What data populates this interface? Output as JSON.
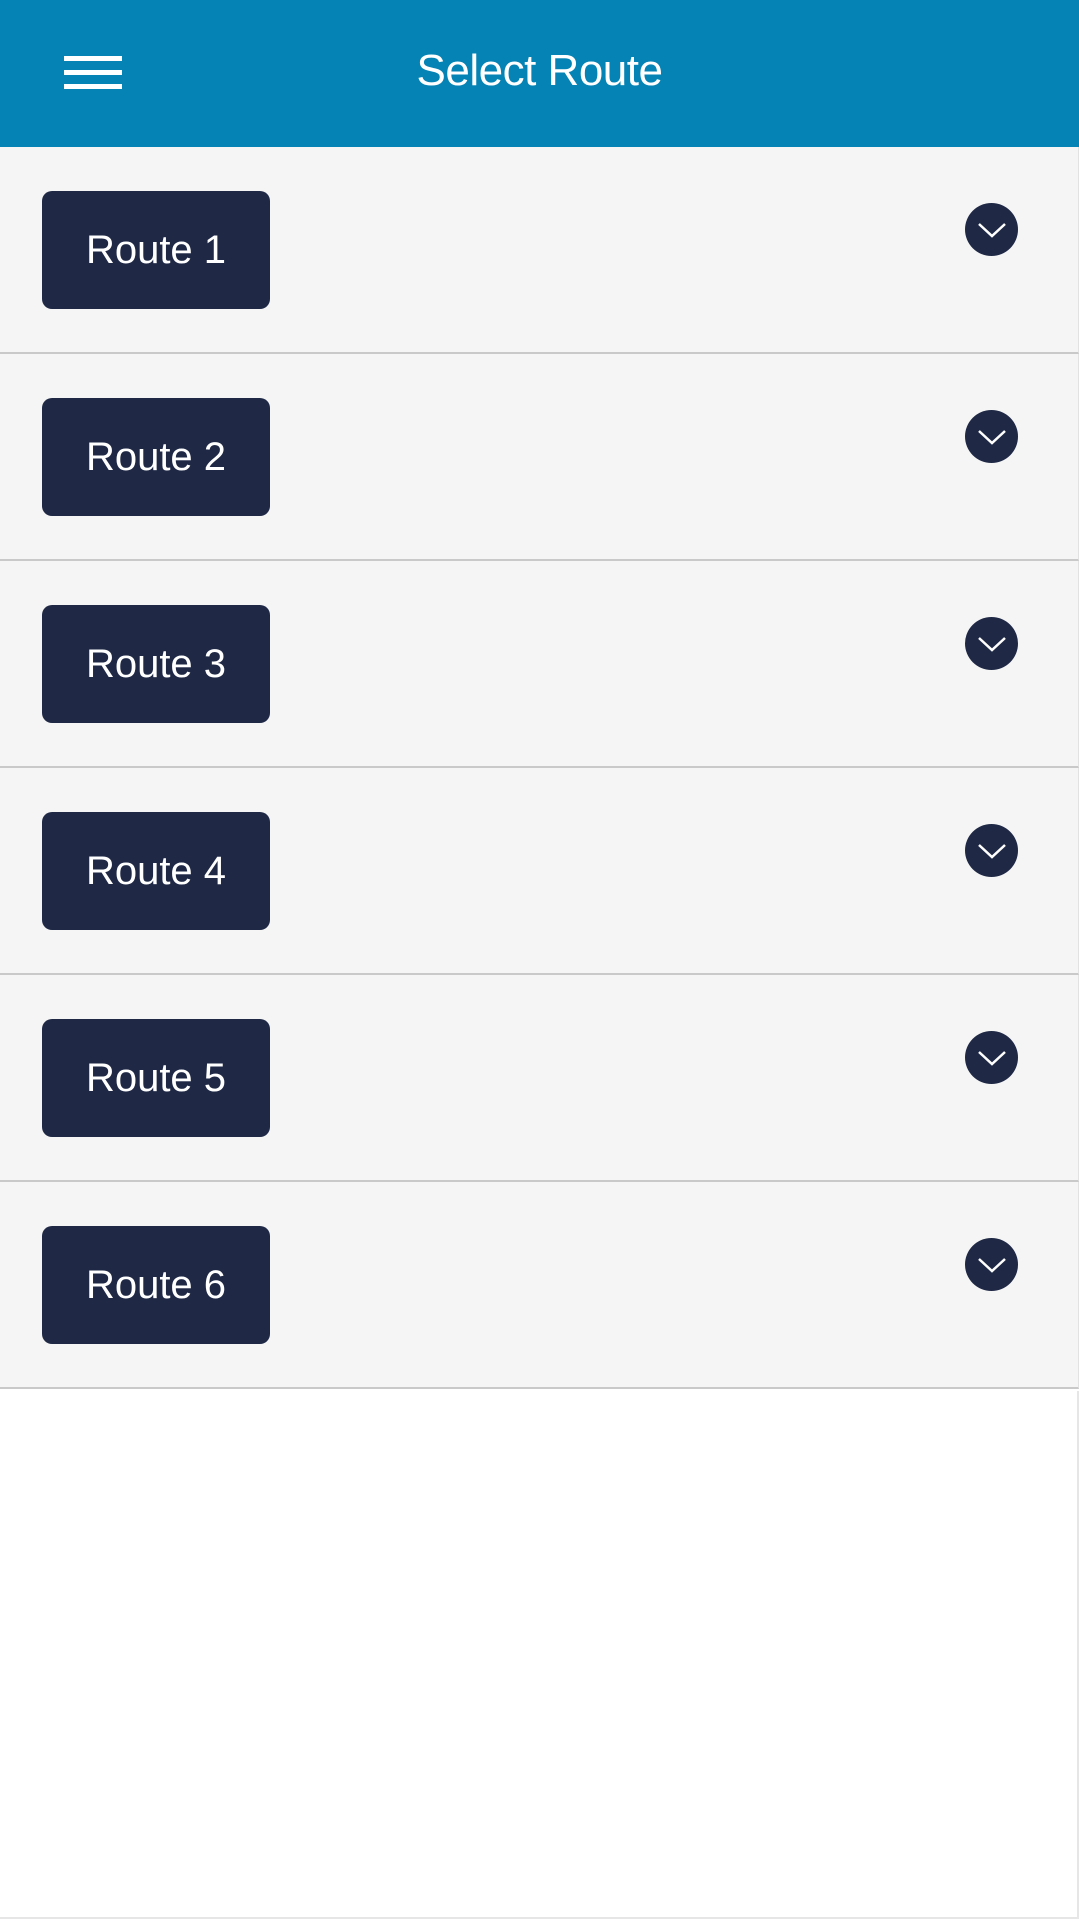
{
  "app_bar": {
    "title": "Select Route",
    "menu_icon": "hamburger-menu-icon",
    "background_color": "#0583b4"
  },
  "routes": [
    {
      "label": "Route 1",
      "toggle_icon": "chevron-down-icon"
    },
    {
      "label": "Route 2",
      "toggle_icon": "chevron-down-icon"
    },
    {
      "label": "Route 3",
      "toggle_icon": "chevron-down-icon"
    },
    {
      "label": "Route 4",
      "toggle_icon": "chevron-down-icon"
    },
    {
      "label": "Route 5",
      "toggle_icon": "chevron-down-icon"
    },
    {
      "label": "Route 6",
      "toggle_icon": "chevron-down-icon"
    }
  ],
  "colors": {
    "route_button": "#1f2946",
    "row_background": "#f5f5f5",
    "divider": "#c9c9c9"
  }
}
